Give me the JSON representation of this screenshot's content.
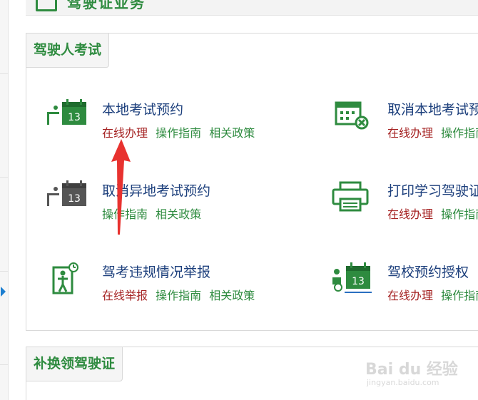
{
  "top_section": {
    "title": "驾驶证业务"
  },
  "sections": [
    {
      "title": "驾驶人考试",
      "items": [
        {
          "name": "本地考试预约",
          "links": [
            {
              "label": "在线办理",
              "tone": "red"
            },
            {
              "label": "操作指南",
              "tone": "green"
            },
            {
              "label": "相关政策",
              "tone": "green"
            }
          ],
          "icon": "calendar-exam-icon"
        },
        {
          "name": "取消本地考试预约",
          "links": [
            {
              "label": "在线办理",
              "tone": "red"
            },
            {
              "label": "操作指南",
              "tone": "green"
            }
          ],
          "icon": "calendar-cancel-icon"
        },
        {
          "name": "取消异地考试预约",
          "links": [
            {
              "label": "操作指南",
              "tone": "green"
            },
            {
              "label": "相关政策",
              "tone": "green"
            }
          ],
          "icon": "calendar-exam-icon"
        },
        {
          "name": "打印学习驾驶证",
          "links": [
            {
              "label": "在线办理",
              "tone": "red"
            },
            {
              "label": "操作指南",
              "tone": "green"
            }
          ],
          "icon": "printer-icon"
        },
        {
          "name": "驾考违规情况举报",
          "links": [
            {
              "label": "在线举报",
              "tone": "red"
            },
            {
              "label": "操作指南",
              "tone": "green"
            },
            {
              "label": "相关政策",
              "tone": "green"
            }
          ],
          "icon": "report-person-icon"
        },
        {
          "name": "驾校预约授权",
          "links": [
            {
              "label": "在线办理",
              "tone": "red"
            },
            {
              "label": "操作指南",
              "tone": "green"
            }
          ],
          "icon": "calendar-authorize-icon"
        }
      ]
    },
    {
      "title": "补换领驾驶证",
      "items": []
    }
  ],
  "calendar_day": "13",
  "watermark": {
    "main": "Bai du 经验",
    "sub": "jingyan.baidu.com"
  },
  "colors": {
    "brand_green": "#2e8b3f",
    "link_red": "#a52222",
    "item_name_blue": "#1c3f7c",
    "annotation_red": "#e8322f"
  }
}
